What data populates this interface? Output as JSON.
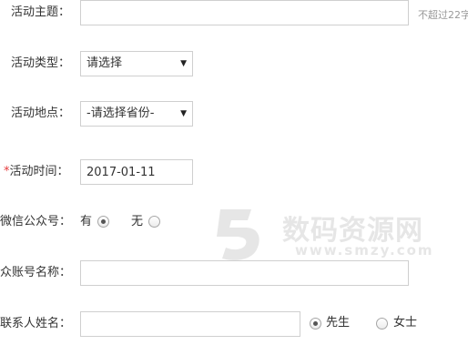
{
  "form": {
    "topic": {
      "label": "活动主题：",
      "value": "",
      "hint": "不超过22字"
    },
    "type": {
      "label": "活动类型：",
      "selected": "请选择"
    },
    "location": {
      "label": "活动地点：",
      "selected": "-请选择省份-"
    },
    "time": {
      "required_mark": "*",
      "label": "活动时间：",
      "value": "2017-01-11"
    },
    "wechat": {
      "label": "微信公众号：",
      "options": [
        {
          "label": "有",
          "checked": true
        },
        {
          "label": "无",
          "checked": false
        }
      ]
    },
    "account_name": {
      "label": "众账号名称：",
      "value": ""
    },
    "contact": {
      "label": "联系人姓名：",
      "value": "",
      "options": [
        {
          "label": "先生",
          "checked": true
        },
        {
          "label": "女士",
          "checked": false
        }
      ]
    }
  },
  "icons": {
    "dropdown": "chevron-down-icon",
    "watermark": "site-logo-watermark"
  },
  "watermark": {
    "title": "数码资源网",
    "url": "www.smzy.com"
  },
  "colors": {
    "required": "#e4393c",
    "border": "#cfcfcf",
    "hint": "#999999",
    "text": "#333333"
  }
}
